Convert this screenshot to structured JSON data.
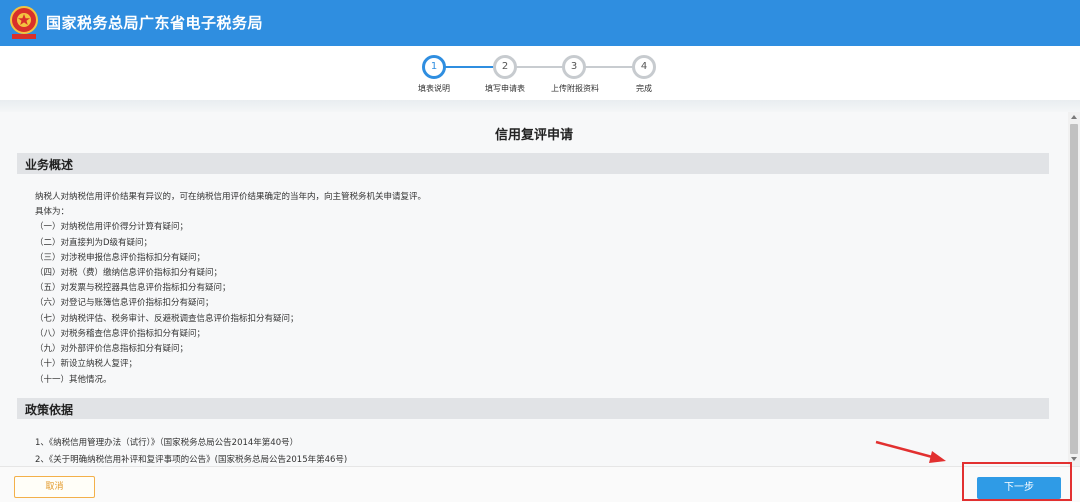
{
  "header": {
    "title": "国家税务总局广东省电子税务局",
    "emblem_icon": "tax-emblem-icon"
  },
  "steps": [
    {
      "number": "1",
      "label": "填表说明",
      "active": true
    },
    {
      "number": "2",
      "label": "填写申请表",
      "active": false
    },
    {
      "number": "3",
      "label": "上传附报资料",
      "active": false
    },
    {
      "number": "4",
      "label": "完成",
      "active": false
    }
  ],
  "page": {
    "title": "信用复评申请"
  },
  "overview": {
    "heading": "业务概述",
    "intro": "纳税人对纳税信用评价结果有异议的，可在纳税信用评价结果确定的当年内，向主管税务机关申请复评。",
    "specific": "具体为：",
    "items": [
      "（一）对纳税信用评价得分计算有疑问；",
      "（二）对直接判为D级有疑问；",
      "（三）对涉税申报信息评价指标扣分有疑问；",
      "（四）对税（费）缴纳信息评价指标扣分有疑问；",
      "（五）对发票与税控器具信息评价指标扣分有疑问；",
      "（六）对登记与账簿信息评价指标扣分有疑问；",
      "（七）对纳税评估、税务审计、反避税调查信息评价指标扣分有疑问；",
      "（八）对税务稽查信息评价指标扣分有疑问；",
      "（九）对外部评价信息指标扣分有疑问；",
      "（十）新设立纳税人复评；",
      "（十一）其他情况。"
    ]
  },
  "policy": {
    "heading": "政策依据",
    "items": [
      "1、《纳税信用管理办法（试行）》（国家税务总局公告2014年第40号）",
      "2、《关于明确纳税信用补评和复评事项的公告》(国家税务总局公告2015年第46号)"
    ]
  },
  "footer": {
    "cancel_label": "取消",
    "next_label": "下一步"
  },
  "colors": {
    "header": "#2f8ee0",
    "accent": "#2f9be6",
    "cancel": "#f3b04a",
    "annotation": "#e23030"
  }
}
